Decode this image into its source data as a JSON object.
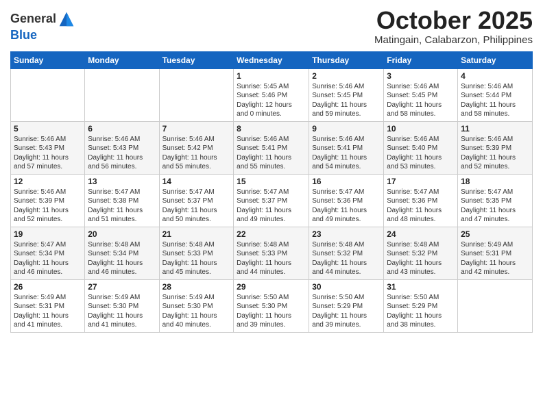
{
  "logo": {
    "general": "General",
    "blue": "Blue"
  },
  "title": "October 2025",
  "location": "Matingain, Calabarzon, Philippines",
  "weekdays": [
    "Sunday",
    "Monday",
    "Tuesday",
    "Wednesday",
    "Thursday",
    "Friday",
    "Saturday"
  ],
  "weeks": [
    [
      {
        "day": "",
        "info": ""
      },
      {
        "day": "",
        "info": ""
      },
      {
        "day": "",
        "info": ""
      },
      {
        "day": "1",
        "info": "Sunrise: 5:45 AM\nSunset: 5:46 PM\nDaylight: 12 hours\nand 0 minutes."
      },
      {
        "day": "2",
        "info": "Sunrise: 5:46 AM\nSunset: 5:45 PM\nDaylight: 11 hours\nand 59 minutes."
      },
      {
        "day": "3",
        "info": "Sunrise: 5:46 AM\nSunset: 5:45 PM\nDaylight: 11 hours\nand 58 minutes."
      },
      {
        "day": "4",
        "info": "Sunrise: 5:46 AM\nSunset: 5:44 PM\nDaylight: 11 hours\nand 58 minutes."
      }
    ],
    [
      {
        "day": "5",
        "info": "Sunrise: 5:46 AM\nSunset: 5:43 PM\nDaylight: 11 hours\nand 57 minutes."
      },
      {
        "day": "6",
        "info": "Sunrise: 5:46 AM\nSunset: 5:43 PM\nDaylight: 11 hours\nand 56 minutes."
      },
      {
        "day": "7",
        "info": "Sunrise: 5:46 AM\nSunset: 5:42 PM\nDaylight: 11 hours\nand 55 minutes."
      },
      {
        "day": "8",
        "info": "Sunrise: 5:46 AM\nSunset: 5:41 PM\nDaylight: 11 hours\nand 55 minutes."
      },
      {
        "day": "9",
        "info": "Sunrise: 5:46 AM\nSunset: 5:41 PM\nDaylight: 11 hours\nand 54 minutes."
      },
      {
        "day": "10",
        "info": "Sunrise: 5:46 AM\nSunset: 5:40 PM\nDaylight: 11 hours\nand 53 minutes."
      },
      {
        "day": "11",
        "info": "Sunrise: 5:46 AM\nSunset: 5:39 PM\nDaylight: 11 hours\nand 52 minutes."
      }
    ],
    [
      {
        "day": "12",
        "info": "Sunrise: 5:46 AM\nSunset: 5:39 PM\nDaylight: 11 hours\nand 52 minutes."
      },
      {
        "day": "13",
        "info": "Sunrise: 5:47 AM\nSunset: 5:38 PM\nDaylight: 11 hours\nand 51 minutes."
      },
      {
        "day": "14",
        "info": "Sunrise: 5:47 AM\nSunset: 5:37 PM\nDaylight: 11 hours\nand 50 minutes."
      },
      {
        "day": "15",
        "info": "Sunrise: 5:47 AM\nSunset: 5:37 PM\nDaylight: 11 hours\nand 49 minutes."
      },
      {
        "day": "16",
        "info": "Sunrise: 5:47 AM\nSunset: 5:36 PM\nDaylight: 11 hours\nand 49 minutes."
      },
      {
        "day": "17",
        "info": "Sunrise: 5:47 AM\nSunset: 5:36 PM\nDaylight: 11 hours\nand 48 minutes."
      },
      {
        "day": "18",
        "info": "Sunrise: 5:47 AM\nSunset: 5:35 PM\nDaylight: 11 hours\nand 47 minutes."
      }
    ],
    [
      {
        "day": "19",
        "info": "Sunrise: 5:47 AM\nSunset: 5:34 PM\nDaylight: 11 hours\nand 46 minutes."
      },
      {
        "day": "20",
        "info": "Sunrise: 5:48 AM\nSunset: 5:34 PM\nDaylight: 11 hours\nand 46 minutes."
      },
      {
        "day": "21",
        "info": "Sunrise: 5:48 AM\nSunset: 5:33 PM\nDaylight: 11 hours\nand 45 minutes."
      },
      {
        "day": "22",
        "info": "Sunrise: 5:48 AM\nSunset: 5:33 PM\nDaylight: 11 hours\nand 44 minutes."
      },
      {
        "day": "23",
        "info": "Sunrise: 5:48 AM\nSunset: 5:32 PM\nDaylight: 11 hours\nand 44 minutes."
      },
      {
        "day": "24",
        "info": "Sunrise: 5:48 AM\nSunset: 5:32 PM\nDaylight: 11 hours\nand 43 minutes."
      },
      {
        "day": "25",
        "info": "Sunrise: 5:49 AM\nSunset: 5:31 PM\nDaylight: 11 hours\nand 42 minutes."
      }
    ],
    [
      {
        "day": "26",
        "info": "Sunrise: 5:49 AM\nSunset: 5:31 PM\nDaylight: 11 hours\nand 41 minutes."
      },
      {
        "day": "27",
        "info": "Sunrise: 5:49 AM\nSunset: 5:30 PM\nDaylight: 11 hours\nand 41 minutes."
      },
      {
        "day": "28",
        "info": "Sunrise: 5:49 AM\nSunset: 5:30 PM\nDaylight: 11 hours\nand 40 minutes."
      },
      {
        "day": "29",
        "info": "Sunrise: 5:50 AM\nSunset: 5:30 PM\nDaylight: 11 hours\nand 39 minutes."
      },
      {
        "day": "30",
        "info": "Sunrise: 5:50 AM\nSunset: 5:29 PM\nDaylight: 11 hours\nand 39 minutes."
      },
      {
        "day": "31",
        "info": "Sunrise: 5:50 AM\nSunset: 5:29 PM\nDaylight: 11 hours\nand 38 minutes."
      },
      {
        "day": "",
        "info": ""
      }
    ]
  ]
}
